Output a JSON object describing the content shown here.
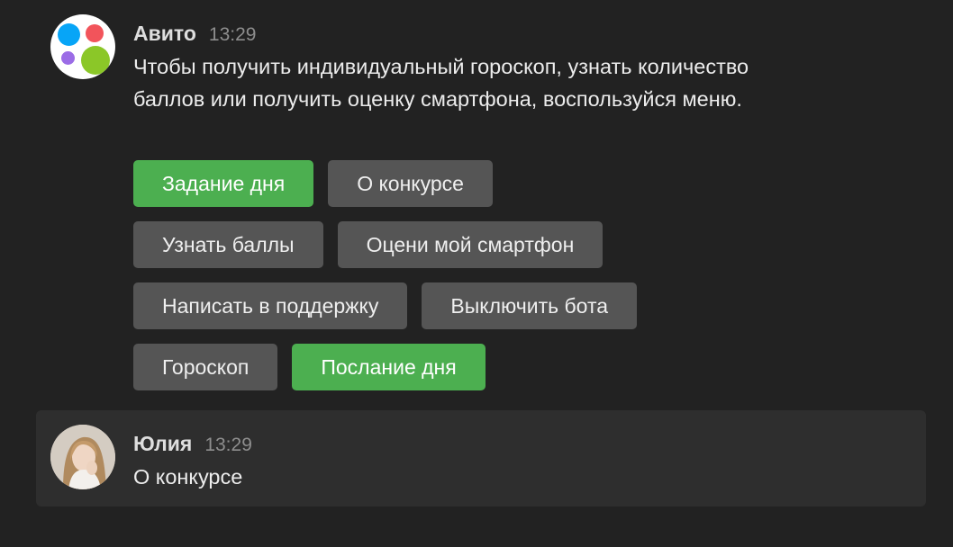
{
  "colors": {
    "background": "#222222",
    "button": "#555555",
    "button_accent": "#4caf50",
    "user_message_bg": "#2e2e2e"
  },
  "bot_message": {
    "author": "Авито",
    "time": "13:29",
    "text": "Чтобы получить индивидуальный гороскоп, узнать количество баллов или получить оценку смартфона, воспользуйся меню.",
    "avatar_icon": "avito-logo-icon",
    "keyboard": {
      "row1": {
        "b1": "Задание дня",
        "b2": "О конкурсе"
      },
      "row2": {
        "b1": "Узнать баллы",
        "b2": "Оцени мой смартфон"
      },
      "row3": {
        "b1": "Написать в поддержку",
        "b2": "Выключить бота"
      },
      "row4": {
        "b1": "Гороскоп",
        "b2": "Послание дня"
      }
    }
  },
  "user_message": {
    "author": "Юлия",
    "time": "13:29",
    "text": "О конкурсе",
    "avatar_icon": "user-photo-avatar"
  }
}
